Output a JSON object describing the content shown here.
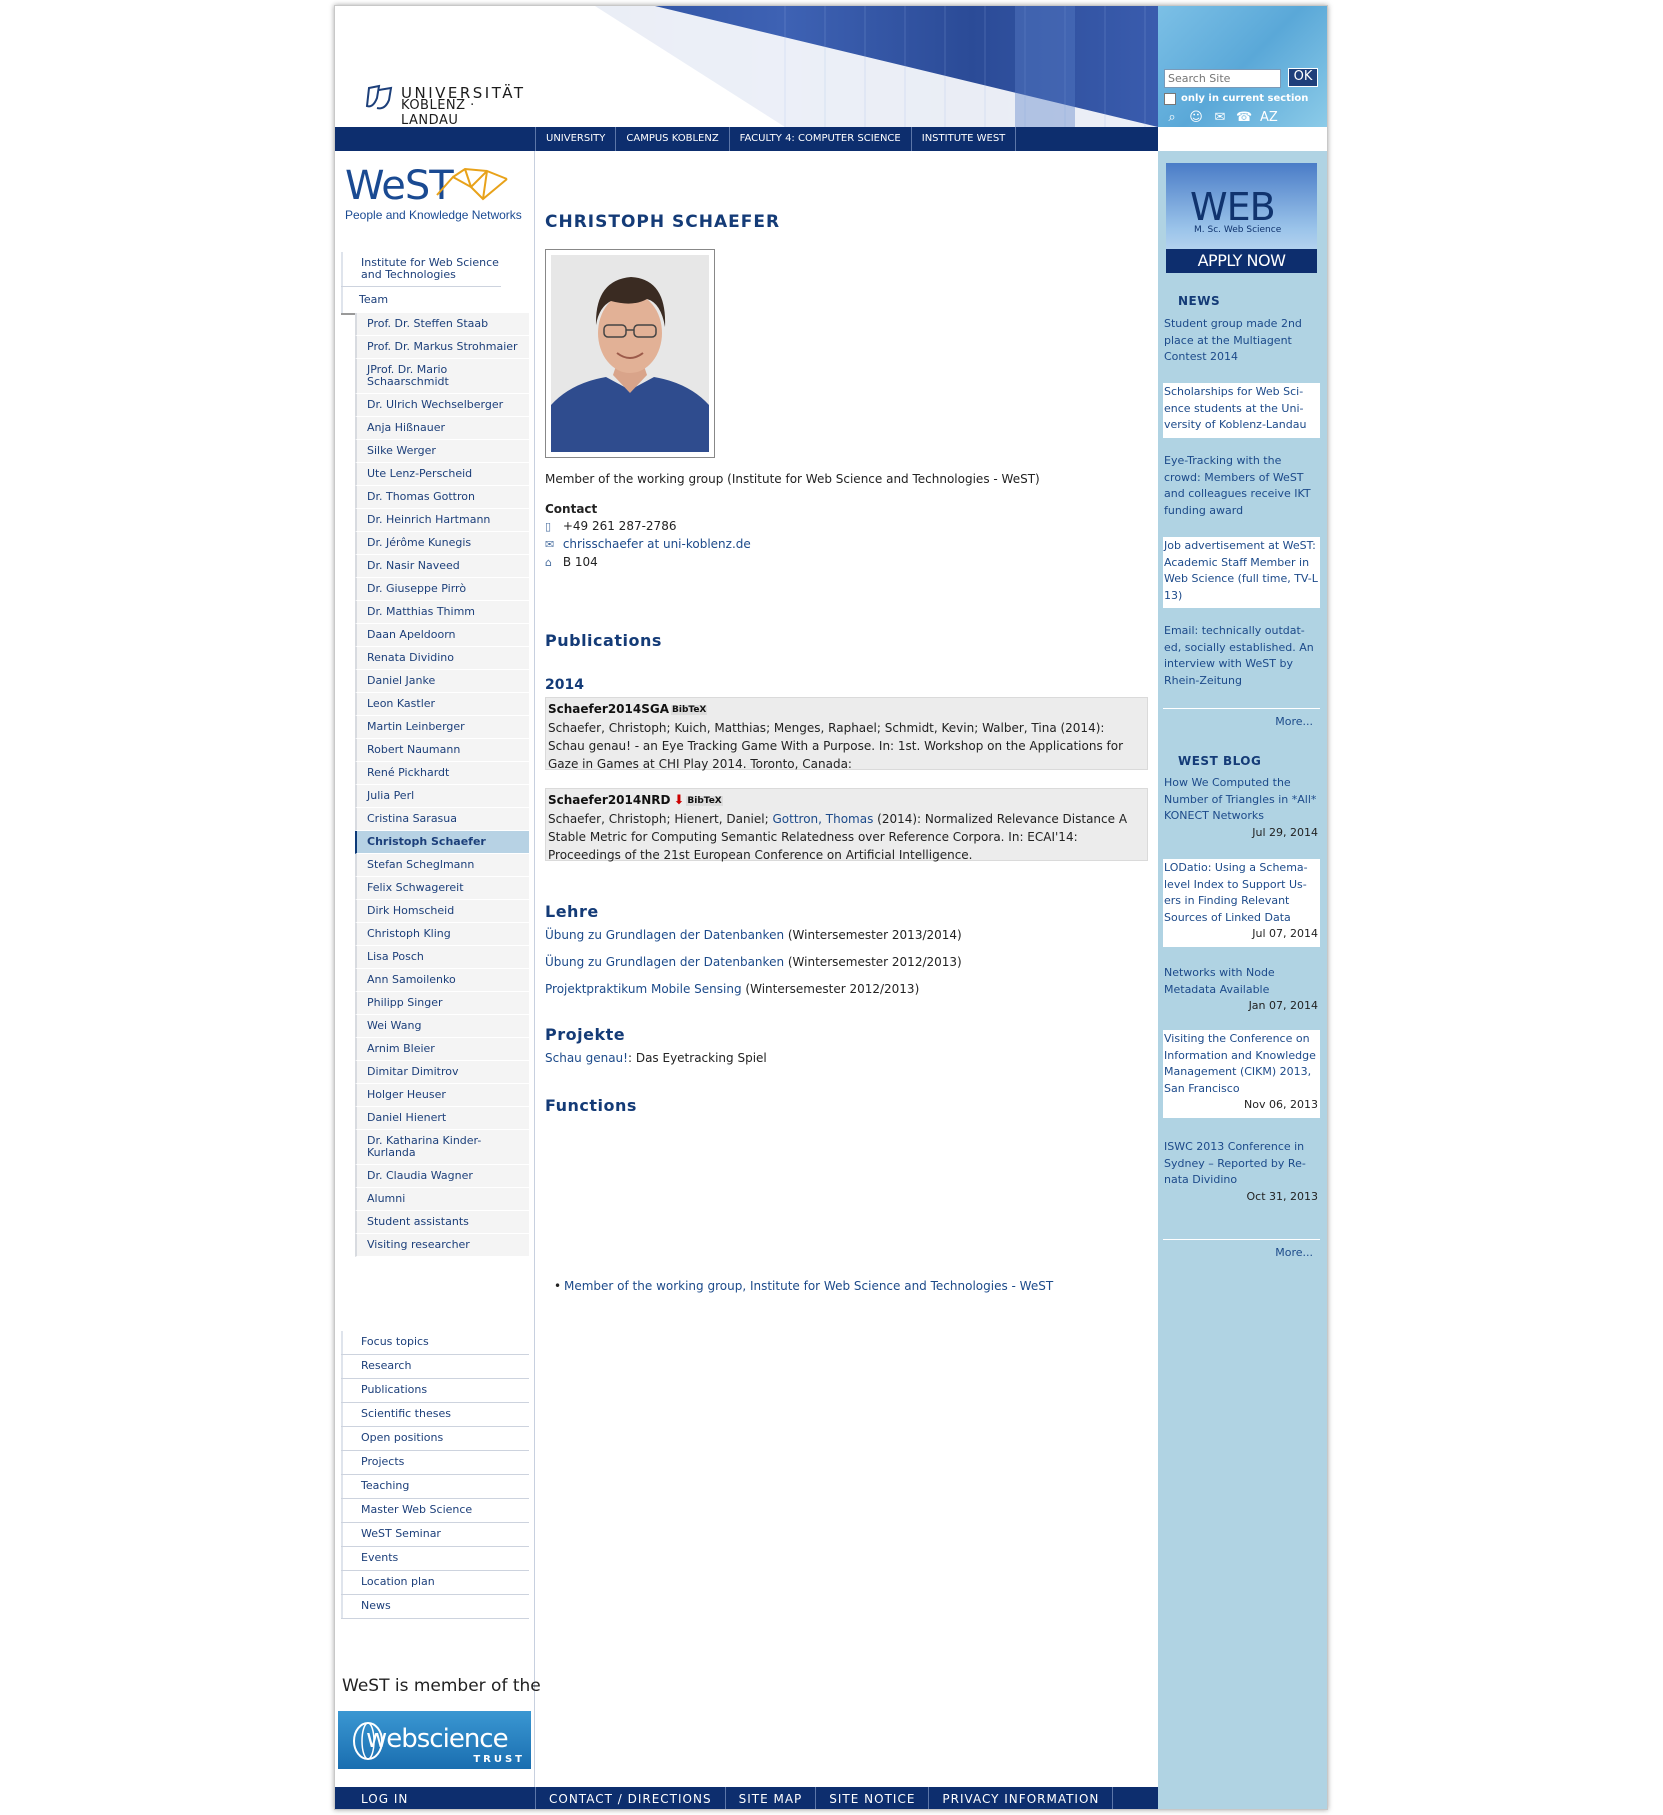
{
  "header": {
    "university_line1": "UNIVERSITÄT",
    "university_line2": "KOBLENZ · LANDAU",
    "search_placeholder": "Search Site",
    "search_button": "OK",
    "section_only_label": "only in current section",
    "icons": [
      "search-icon",
      "person-icon",
      "mail-icon",
      "phone-icon",
      "az-icon"
    ]
  },
  "topnav": [
    "UNIVERSITY",
    "CAMPUS KOBLENZ",
    "FACULTY 4: COMPUTER SCIENCE",
    "INSTITUTE WEST"
  ],
  "sidebar": {
    "logo_text": "WeST",
    "logo_subtitle": "People and Knowledge Networks",
    "institute": "Institute for Web Science and Technologies",
    "team": "Team",
    "members": [
      "Prof. Dr. Steffen Staab",
      "Prof. Dr. Markus Strohmaier",
      "JProf. Dr. Mario Schaarschmidt",
      "Dr. Ulrich Wechselberger",
      "Anja Hißnauer",
      "Silke Werger",
      "Ute Lenz-Perscheid",
      "Dr. Thomas Gottron",
      "Dr. Heinrich Hartmann",
      "Dr. Jérôme Kunegis",
      "Dr. Nasir Naveed",
      "Dr. Giuseppe Pirrò",
      "Dr. Matthias Thimm",
      "Daan Apeldoorn",
      "Renata Dividino",
      "Daniel Janke",
      "Leon Kastler",
      "Martin Leinberger",
      "Robert Naumann",
      "René Pickhardt",
      "Julia Perl",
      "Cristina Sarasua",
      "Christoph Schaefer",
      "Stefan Scheglmann",
      "Felix Schwagereit",
      "Dirk Homscheid",
      "Christoph Kling",
      "Lisa Posch",
      "Ann Samoilenko",
      "Philipp Singer",
      "Wei Wang",
      "Arnim Bleier",
      "Dimitar Dimitrov",
      "Holger Heuser",
      "Daniel Hienert",
      "Dr. Katharina Kinder-Kurlanda",
      "Dr. Claudia Wagner",
      "Alumni",
      "Student assistants",
      "Visiting researcher"
    ],
    "bottom_items": [
      "Focus topics",
      "Research",
      "Publications",
      "Scientific theses",
      "Open positions",
      "Projects",
      "Teaching",
      "Master Web Science",
      "WeST Seminar",
      "Events",
      "Location plan",
      "News"
    ],
    "member_of_text": "WeST is member of the",
    "webscience_logo": "webscience",
    "webscience_trust": "TRUST"
  },
  "main": {
    "title": "CHRISTOPH SCHAEFER",
    "member_of": "Member of the working group (Institute for Web Science and Technologies - WeST)",
    "contact_heading": "Contact",
    "phone": "+49 261 287-2786",
    "email": "chrisschaefer at uni-koblenz.de",
    "room": "B 104",
    "publications_heading": "Publications",
    "year": "2014",
    "pubs": [
      {
        "key": "Schaefer2014SGA",
        "bibtex": "BibTeX",
        "text": "Schaefer, Christoph; Kuich, Matthias; Menges, Raphael; Schmidt, Kevin; Walber, Tina (2014): Schau genau! - an Eye Tracking Game With a Purpose. In: 1st. Workshop on the Applications for Gaze in Games at CHI Play 2014. Toronto, Canada:"
      },
      {
        "key": "Schaefer2014NRD",
        "bibtex": "BibTeX",
        "text_a": "Schaefer, Christoph; Hienert, Daniel; ",
        "link": "Gottron, Thomas",
        "text_b": " (2014): Normalized Relevance Distance  A Stable Metric for Computing Semantic Relatedness over Reference Corpora. In: ECAI'14: Proceedings of the 21st European Conference on Artificial Intelligence."
      }
    ],
    "lehre_heading": "Lehre",
    "lehre": [
      {
        "link": "Übung zu Grundlagen der Datenbanken",
        "term": " (Wintersemester 2013/2014)"
      },
      {
        "link": "Übung zu Grundlagen der Datenbanken",
        "term": " (Wintersemester 2012/2013)"
      },
      {
        "link": "Projektpraktikum Mobile Sensing",
        "term": " (Wintersemester 2012/2013)"
      }
    ],
    "projekte_heading": "Projekte",
    "projekt_link": "Schau genau!",
    "projekt_text": ": Das Eyetracking Spiel",
    "functions_heading": "Functions",
    "function_item": "Member of the working group,  Institute for Web Science and Technologies - WeST"
  },
  "right": {
    "apply_web": "WEB",
    "apply_msc": "M. Sc. Web Science",
    "apply_button": "APPLY NOW",
    "news_heading": "NEWS",
    "news": [
      "Student group made 2nd place at the Multiagent Contest 2014",
      "Scholarships for Web Sci-ence students at the Uni-versity of Koblenz-Landau",
      "Eye-Tracking with the crowd: Members of WeST and colleagues receive IKT funding award",
      "Job advertisement at WeST: Academic Staff Member in Web Science (full time, TV-L 13)",
      "Email: technically outdat-ed, socially established. An interview with WeST by Rhein-Zeitung"
    ],
    "more": "More...",
    "blog_heading": "WEST BLOG",
    "blog": [
      {
        "title": "How We Computed the Number of Triangles in *All* KONECT Networks",
        "date": "Jul 29, 2014"
      },
      {
        "title": "LODatio: Using a Schema-level Index to Support Us-ers in Finding Relevant Sources of Linked Data",
        "date": "Jul 07, 2014"
      },
      {
        "title": "Networks with Node Metadata Available",
        "date": "Jan 07, 2014"
      },
      {
        "title": "Visiting the Conference on Information and Knowledge Management (CIKM) 2013, San Francisco",
        "date": "Nov 06, 2013"
      },
      {
        "title": "ISWC 2013 Conference in Sydney – Reported by Re-nata Dividino",
        "date": "Oct 31, 2013"
      }
    ]
  },
  "footer": {
    "login": "LOG IN",
    "links": [
      "CONTACT / DIRECTIONS",
      "SITE MAP",
      "SITE NOTICE",
      "PRIVACY INFORMATION"
    ]
  }
}
